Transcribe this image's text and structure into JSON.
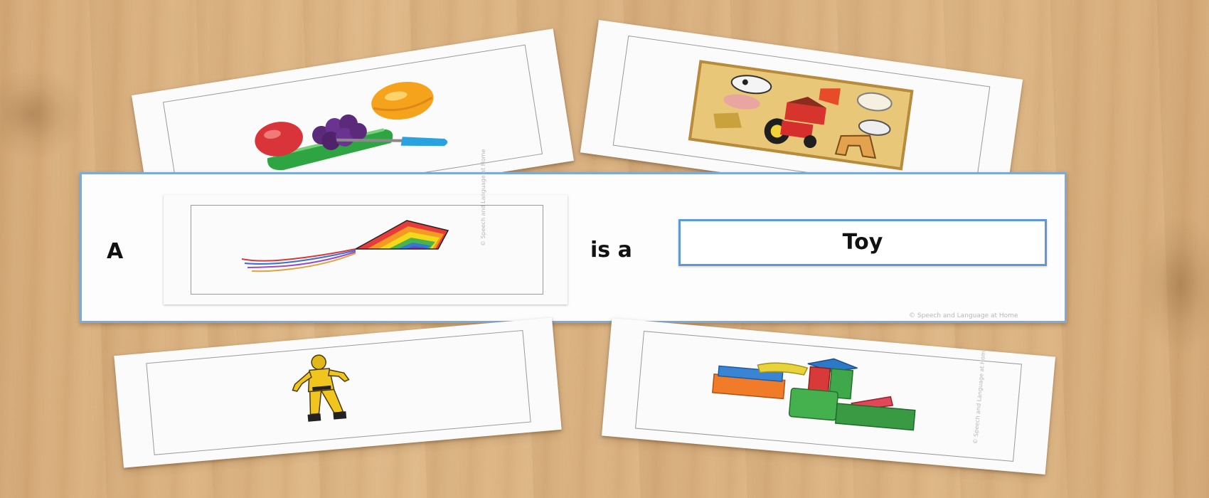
{
  "scene": {
    "description_free": true
  },
  "sentence_strip": {
    "article": "A",
    "connector": "is a",
    "category_word": "Toy",
    "strip_copyright": "© Speech and Language at Home"
  },
  "cards": {
    "kite_card": {
      "picture": "kite-icon",
      "copyright": "© Speech and Language at Home"
    },
    "fruit_card": {
      "picture": "toy-fruit-icon"
    },
    "puzzle_card": {
      "picture": "farm-puzzle-icon"
    },
    "action_figure_card": {
      "picture": "action-figure-icon"
    },
    "blocks_card": {
      "picture": "building-blocks-icon",
      "copyright": "© Speech and Language at Home"
    }
  },
  "colors": {
    "strip_border": "#7fa9d6",
    "word_card_border": "#5f98d2",
    "table_wood": "#d9b080"
  }
}
